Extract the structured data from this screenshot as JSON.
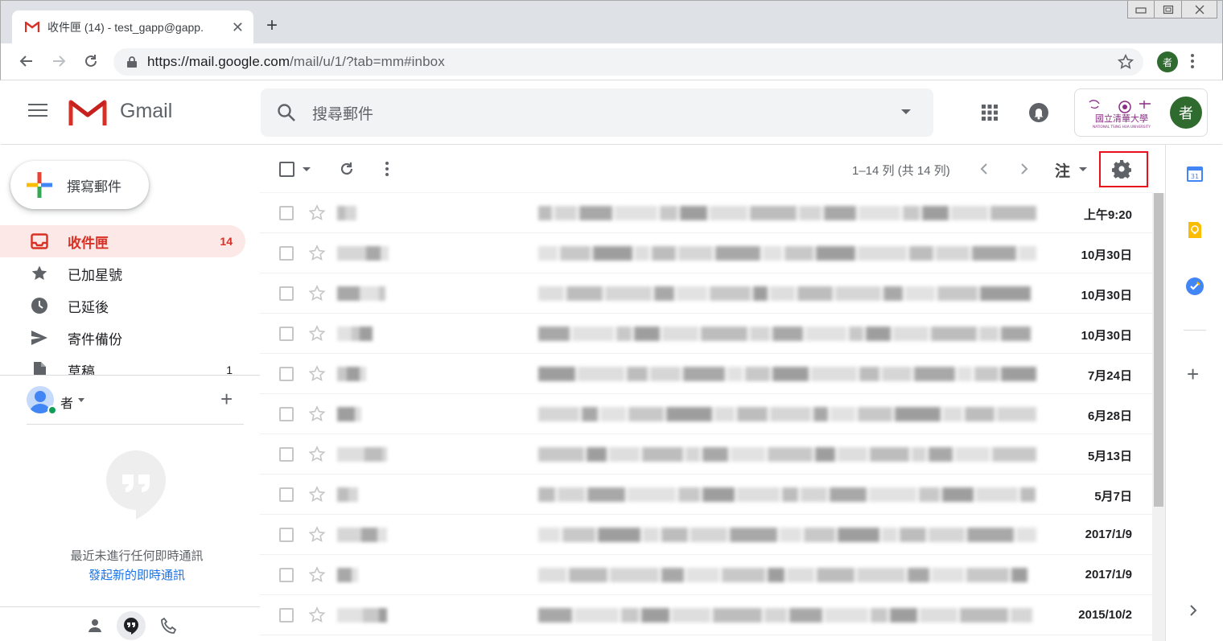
{
  "browser": {
    "tab_title": "收件匣 (14) - test_gapp@gapp.",
    "new_tab": "+",
    "url_host": "https://mail.google.com",
    "url_path": "/mail/u/1/?tab=mm#inbox",
    "profile_initial": "者"
  },
  "header": {
    "app_name": "Gmail",
    "search_placeholder": "搜尋郵件",
    "account_initial": "者",
    "org_logo_text": "國立清華大學",
    "org_logo_sub": "NATIONAL TSING HUA UNIVERSITY"
  },
  "sidebar": {
    "compose_label": "撰寫郵件",
    "items": [
      {
        "label": "收件匣",
        "count": "14",
        "icon": "inbox-icon"
      },
      {
        "label": "已加星號",
        "count": "",
        "icon": "star-icon"
      },
      {
        "label": "已延後",
        "count": "",
        "icon": "clock-icon"
      },
      {
        "label": "寄件備份",
        "count": "",
        "icon": "send-icon"
      },
      {
        "label": "草稿",
        "count": "1",
        "icon": "draft-icon"
      }
    ],
    "hangouts_user": "者",
    "no_chats": "最近未進行任何即時通訊",
    "start_chat": "發起新的即時通訊"
  },
  "list_toolbar": {
    "pagination": "1–14 列 (共 14 列)",
    "input_tool": "注"
  },
  "emails": [
    {
      "date": "上午9:20"
    },
    {
      "date": "10月30日"
    },
    {
      "date": "10月30日"
    },
    {
      "date": "10月30日"
    },
    {
      "date": "7月24日"
    },
    {
      "date": "6月28日"
    },
    {
      "date": "5月13日"
    },
    {
      "date": "5月7日"
    },
    {
      "date": "2017/1/9"
    },
    {
      "date": "2017/1/9"
    },
    {
      "date": "2015/10/2"
    }
  ],
  "colors": {
    "accent_red": "#d93025",
    "active_bg": "#fce8e6",
    "highlight_box": "#e8101a",
    "link_blue": "#1a73e8"
  }
}
